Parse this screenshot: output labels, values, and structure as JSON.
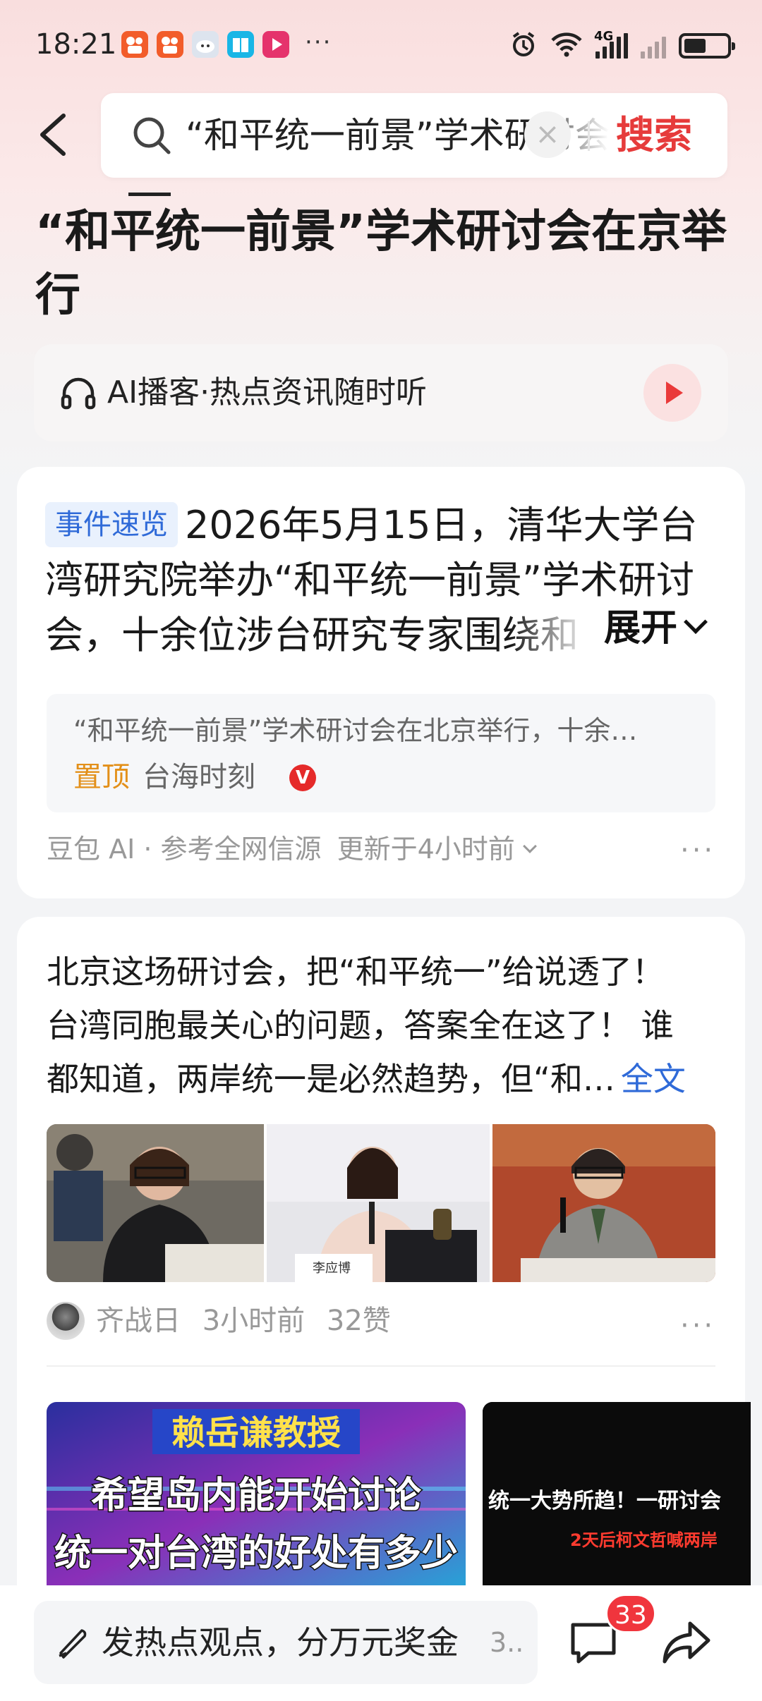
{
  "status_bar": {
    "time": "18:21",
    "more_dots": "···",
    "network": "4G",
    "app_icons": [
      "kuaishou-icon",
      "kuaishou-icon",
      "cloud-app-icon",
      "book-app-icon",
      "video-app-icon"
    ],
    "status_icons": [
      "alarm-icon",
      "wifi-icon",
      "signal-icon",
      "signal-off-icon",
      "battery-icon"
    ]
  },
  "search": {
    "query": "“和平统一前景”学术研讨会在京举行",
    "clear_symbol": "×",
    "button_label": "搜索"
  },
  "article": {
    "title": "“和平统一前景”学术研讨会在京举行"
  },
  "podcast": {
    "label": "AI播客·热点资讯随时听"
  },
  "event_card": {
    "tag": "事件速览",
    "summary": "2026年5月15日，清华大学台湾研究院举办“和平统一前景”学术研讨会，十余位涉台研究专家围绕和",
    "expand_label": "展开",
    "ref_title": "“和平统一前景”学术研讨会在北京举行，十余…",
    "ref_pinned": "置顶",
    "ref_source": "台海时刻",
    "ref_badge": "V",
    "footer_source": "豆包 AI · 参考全网信源",
    "footer_updated": "更新于4小时前",
    "more": "···"
  },
  "post": {
    "line1": "北京这场研讨会，把“和平统一”给说透了！",
    "line2": "台湾同胞最关心的问题，答案全在这了！ 谁",
    "line3": "都知道，两岸统一是必然趋势，但“和…",
    "fulltext_label": "全文",
    "photo_caption_2": "李应博",
    "author": "齐战日",
    "time": "3小时前",
    "likes": "32赞",
    "more": "···"
  },
  "videos": [
    {
      "line1": "赖岳谦教授",
      "line2": "希望岛内能开始讨论",
      "line3": "统一对台湾的好处有多少"
    },
    {
      "headline": "统一大势所趋！一研讨会",
      "subline": "2天后柯文哲喊两岸"
    }
  ],
  "bottom_bar": {
    "input_placeholder": "发热点观点，分万元奖金",
    "input_suffix": "3..",
    "comment_count": "33"
  },
  "colors": {
    "accent_red": "#e63b3b",
    "link_blue": "#2f6ad8",
    "pin_orange": "#e3901a",
    "badge_red": "#f0353d"
  }
}
